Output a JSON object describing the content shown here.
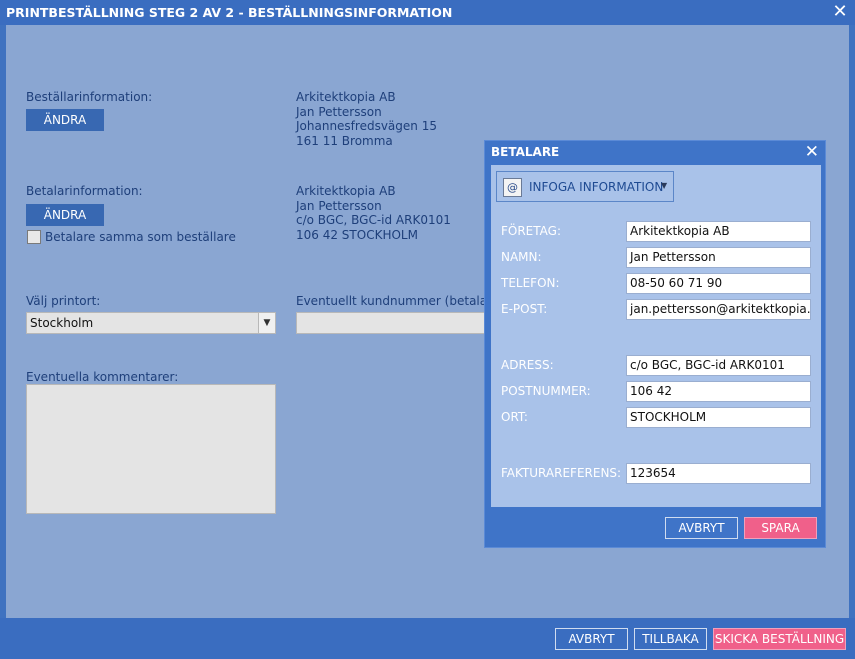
{
  "window": {
    "title": "PRINTBESTÄLLNING STEG 2 AV 2 - BESTÄLLNINGSINFORMATION",
    "close_glyph": "✕"
  },
  "orderer": {
    "label": "Beställarinformation:",
    "change_button": "ÄNDRA",
    "address": [
      "Arkitektkopia AB",
      "Jan Pettersson",
      "Johannesfredsvägen 15",
      "161 11 Bromma"
    ]
  },
  "payer": {
    "label": "Betalarinformation:",
    "change_button": "ÄNDRA",
    "same_checkbox_label": "Betalare samma som beställare",
    "same_checked": false,
    "address": [
      "Arkitektkopia AB",
      "Jan Pettersson",
      "c/o BGC, BGC-id ARK0101",
      "106 42 STOCKHOLM"
    ]
  },
  "print_location": {
    "label": "Välj printort:",
    "selected": "Stockholm"
  },
  "customer_number": {
    "label": "Eventuellt kundnummer (betalare)",
    "value": ""
  },
  "comments": {
    "label": "Eventuella kommentarer:",
    "value": ""
  },
  "footer": {
    "cancel": "AVBRYT",
    "back": "TILLBAKA",
    "send": "SKICKA BESTÄLLNING"
  },
  "dialog": {
    "title": "BETALARE",
    "close_glyph": "✕",
    "insert_info_button": "INFOGA INFORMATION",
    "insert_icon": "address-book-icon",
    "fields": {
      "company": {
        "label": "FÖRETAG:",
        "value": "Arkitektkopia AB"
      },
      "name": {
        "label": "NAMN:",
        "value": "Jan Pettersson"
      },
      "phone": {
        "label": "TELEFON:",
        "value": "08-50 60 71 90"
      },
      "email": {
        "label": "E-POST:",
        "value": "jan.pettersson@arkitektkopia.se"
      },
      "address": {
        "label": "ADRESS:",
        "value": "c/o BGC, BGC-id ARK0101"
      },
      "postal_code": {
        "label": "POSTNUMMER:",
        "value": "106 42"
      },
      "city": {
        "label": "ORT:",
        "value": "STOCKHOLM"
      },
      "invoice_ref": {
        "label": "FAKTURAREFERENS:",
        "value": "123654"
      }
    },
    "cancel": "AVBRYT",
    "save": "SPARA"
  },
  "colors": {
    "titlebar": "#3a6dc0",
    "content_bg": "#8aa6d2",
    "dialog_bg": "#3f74c8",
    "dialog_inner": "#a9c2e9",
    "accent_pink": "#f0608a"
  }
}
